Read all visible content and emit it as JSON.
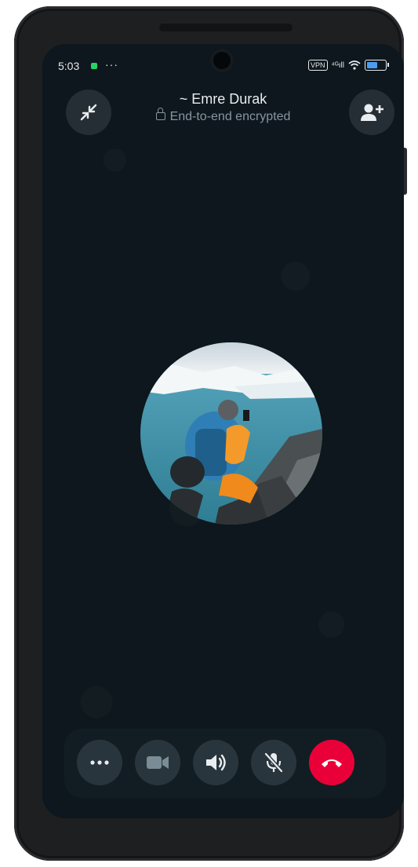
{
  "status_bar": {
    "time": "5:03",
    "more": "···",
    "vpn_label": "VPN",
    "signal_label": "⁴ᴳıll",
    "battery_level": 0.66
  },
  "call": {
    "contact_name": "~ Emre Durak",
    "encryption_status": "End-to-end encrypted"
  },
  "controls": {
    "more_icon": "more-icon",
    "video_icon": "video-icon",
    "speaker_icon": "speaker-icon",
    "mute_icon": "mic-off-icon",
    "end_icon": "end-call-icon"
  },
  "colors": {
    "accent_end": "#ea0038",
    "status_dot": "#25d366",
    "background": "#0b141a"
  }
}
